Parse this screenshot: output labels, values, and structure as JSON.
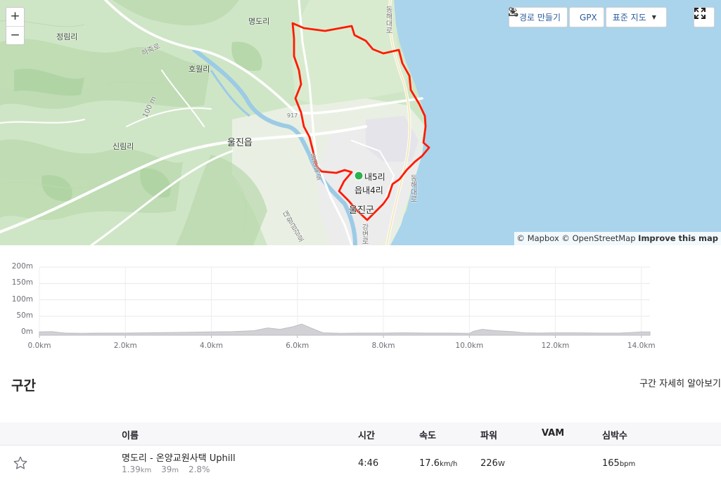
{
  "map": {
    "zoom_in": "+",
    "zoom_out": "−",
    "labels": {
      "myeongdo": "명도리",
      "jeongrim": "정림리",
      "hojuk": "하죽로",
      "howol": "호월리",
      "contour100": "100 m",
      "road917": "917",
      "uljin_eup": "울진읍",
      "sinrim": "신림리",
      "nae5ri": "내5리",
      "eupnae4ri": "읍내4리",
      "uljin_gun": "울진군",
      "donghae_daero_n": "동해대로",
      "donghae_daero_s": "동해대로",
      "daewang": "대왕금강로",
      "uljin_bukro": "울진북로",
      "gangbyeon": "강변로"
    },
    "buttons": {
      "make_route": "경로 만들기",
      "gpx": "GPX",
      "map_style": "표준 지도"
    },
    "attribution": {
      "mapbox": "© Mapbox",
      "osm": "© OpenStreetMap",
      "improve": "Improve this map"
    }
  },
  "elevation": {
    "y_ticks": [
      "200m",
      "150m",
      "100m",
      "50m",
      "0m"
    ],
    "x_ticks": [
      "0.0km",
      "2.0km",
      "4.0km",
      "6.0km",
      "8.0km",
      "10.0km",
      "12.0km",
      "14.0km"
    ],
    "profile_km": [
      0,
      0.3,
      0.6,
      1.0,
      1.5,
      2.0,
      2.5,
      3.0,
      3.5,
      4.0,
      4.5,
      5.0,
      5.3,
      5.6,
      5.9,
      6.1,
      6.3,
      6.6,
      7.0,
      7.5,
      8.0,
      8.5,
      9.0,
      9.5,
      10.0,
      10.1,
      10.3,
      10.6,
      11.0,
      11.3,
      11.6,
      12.0,
      12.5,
      13.0,
      13.5,
      14.0,
      14.2
    ],
    "profile_m": [
      2,
      3,
      -2,
      -3,
      -2,
      -2,
      -1,
      0,
      1,
      2,
      3,
      6,
      14,
      10,
      18,
      26,
      15,
      -1,
      -3,
      -2,
      -2,
      -1,
      -2,
      -2,
      -3,
      4,
      10,
      6,
      3,
      -1,
      -2,
      -1,
      -1,
      -2,
      -2,
      2,
      2
    ],
    "y_min": -8,
    "y_max": 200,
    "x_max": 14.2
  },
  "segments": {
    "title": "구간",
    "learn_more": "구간 자세히 알아보기",
    "columns": {
      "name": "이름",
      "time": "시간",
      "speed": "속도",
      "power": "파워",
      "vam": "VAM",
      "hr": "심박수"
    },
    "rows": [
      {
        "name": "명도리 - 온양교원사택 Uphill",
        "distance": "1.39",
        "distance_unit": "km",
        "elev_gain": "39",
        "elev_unit": "m",
        "grade": "2.8%",
        "time": "4:46",
        "speed": "17.6",
        "speed_unit": "km/h",
        "power": "226",
        "power_unit": "W",
        "vam": "",
        "hr": "165",
        "hr_unit": "bpm"
      }
    ]
  }
}
